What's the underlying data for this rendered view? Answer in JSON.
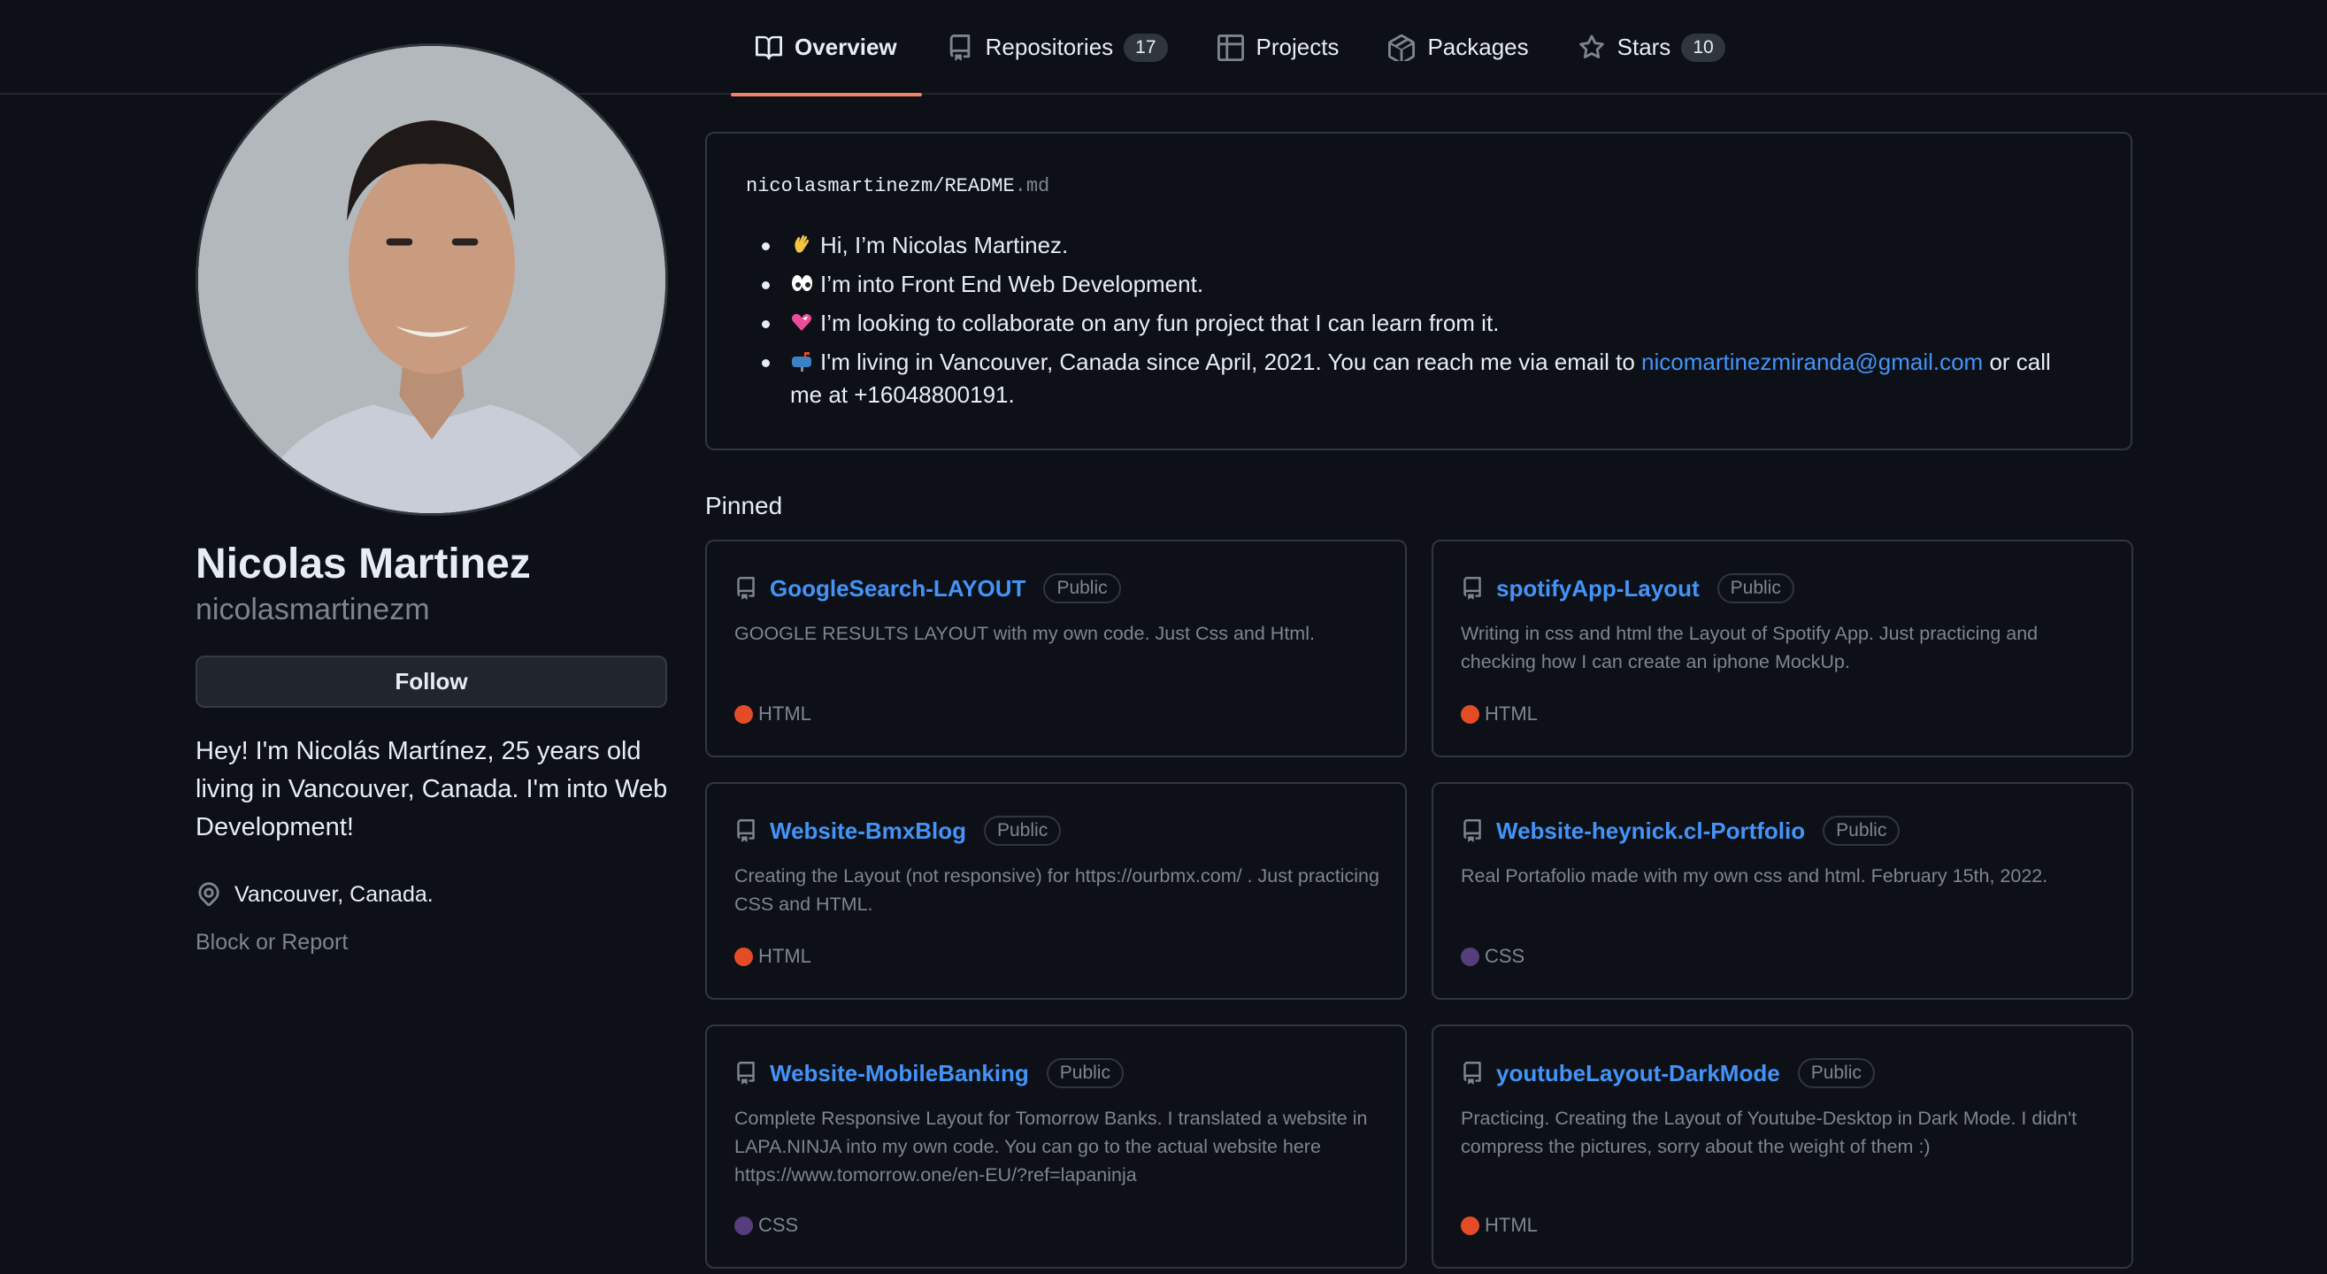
{
  "colors": {
    "background": "#0d1117",
    "link": "#4493f8",
    "tab_underline": "#f78166",
    "html_lang": "#e34c26",
    "css_lang": "#563d7c"
  },
  "nav": {
    "tabs": [
      {
        "label": "Overview",
        "icon": "book-icon",
        "count": null
      },
      {
        "label": "Repositories",
        "icon": "repo-icon",
        "count": "17"
      },
      {
        "label": "Projects",
        "icon": "table-icon",
        "count": null
      },
      {
        "label": "Packages",
        "icon": "package-icon",
        "count": null
      },
      {
        "label": "Stars",
        "icon": "star-icon",
        "count": "10"
      }
    ]
  },
  "profile": {
    "name": "Nicolas Martinez",
    "login": "nicolasmartinezm",
    "follow_label": "Follow",
    "bio": "Hey! I'm Nicolás Martínez, 25 years old living in Vancouver, Canada. I'm into Web Development!",
    "location": "Vancouver, Canada.",
    "block_label": "Block or Report"
  },
  "readme": {
    "owner": "nicolasmartinezm",
    "separator": "/",
    "file": "README",
    "ext": ".md",
    "items": [
      {
        "emoji": "wave",
        "text": "Hi, I’m Nicolas Martinez."
      },
      {
        "emoji": "eyes",
        "text": "I’m into Front End Web Development."
      },
      {
        "emoji": "heart",
        "text": "I’m looking to collaborate on any fun project that I can learn from it."
      }
    ],
    "contact": {
      "emoji": "mailbox",
      "before": "I'm living in Vancouver, Canada since April, 2021. You can reach me via email to ",
      "email": "nicomartinezmiranda@gmail.com",
      "after": " or call me at +16048800191."
    }
  },
  "pinned": {
    "title": "Pinned",
    "repos": [
      {
        "name": "GoogleSearch-LAYOUT",
        "badge": "Public",
        "desc": "GOOGLE RESULTS LAYOUT with my own code. Just Css and Html.",
        "lang": "HTML",
        "lang_color": "#e34c26"
      },
      {
        "name": "spotifyApp-Layout",
        "badge": "Public",
        "desc": "Writing in css and html the Layout of Spotify App. Just practicing and checking how I can create an iphone MockUp.",
        "lang": "HTML",
        "lang_color": "#e34c26"
      },
      {
        "name": "Website-BmxBlog",
        "badge": "Public",
        "desc": "Creating the Layout (not responsive) for https://ourbmx.com/ . Just practicing CSS and HTML.",
        "lang": "HTML",
        "lang_color": "#e34c26"
      },
      {
        "name": "Website-heynick.cl-Portfolio",
        "badge": "Public",
        "desc": "Real Portafolio made with my own css and html. February 15th, 2022.",
        "lang": "CSS",
        "lang_color": "#563d7c"
      },
      {
        "name": "Website-MobileBanking",
        "badge": "Public",
        "desc": "Complete Responsive Layout for Tomorrow Banks. I translated a website in LAPA.NINJA into my own code. You can go to the actual website here https://www.tomorrow.one/en-EU/?ref=lapaninja",
        "lang": "CSS",
        "lang_color": "#563d7c"
      },
      {
        "name": "youtubeLayout-DarkMode",
        "badge": "Public",
        "desc": "Practicing. Creating the Layout of Youtube-Desktop in Dark Mode. I didn't compress the pictures, sorry about the weight of them :)",
        "lang": "HTML",
        "lang_color": "#e34c26"
      }
    ]
  }
}
